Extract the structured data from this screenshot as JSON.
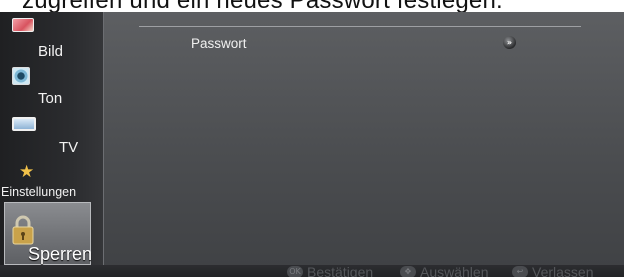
{
  "caption": {
    "text": "zugreifen und ein neues Passwort festlegen."
  },
  "sidebar": {
    "items": [
      {
        "label": "Bild",
        "icon": "picture-icon"
      },
      {
        "label": "Ton",
        "icon": "speaker-icon"
      },
      {
        "label": "TV",
        "icon": "tv-icon"
      },
      {
        "label": "Einstellungen",
        "icon": "star-icon"
      },
      {
        "label": "Sperren",
        "icon": "padlock-icon",
        "selected": true
      }
    ]
  },
  "main": {
    "rows": [
      {
        "label": "Passwort",
        "action_icon": "double-chevron-right-icon"
      }
    ]
  },
  "footer": {
    "hints": [
      {
        "label": "Bestätigen",
        "icon": "ok-button-icon",
        "glyph": "OK"
      },
      {
        "label": "Auswählen",
        "icon": "dpad-icon",
        "glyph": "✥"
      },
      {
        "label": "Verlassen",
        "icon": "return-icon",
        "glyph": "↩"
      }
    ]
  },
  "colors": {
    "panel": "#4d4f52",
    "sidebar": "#26272a",
    "selected": "#75777b",
    "text": "#f0f0f0",
    "hint_text": "#55575b"
  }
}
